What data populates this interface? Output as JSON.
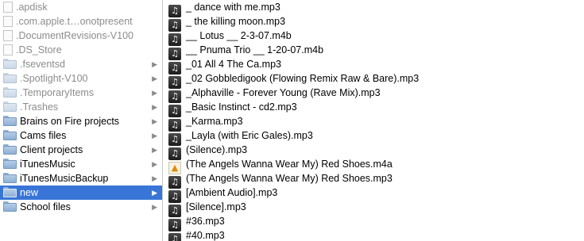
{
  "left_column": {
    "items": [
      {
        "label": ".apdisk",
        "kind": "file",
        "dim": true,
        "has_children": false,
        "selected": false
      },
      {
        "label": ".com.apple.t…onotpresent",
        "kind": "file",
        "dim": true,
        "has_children": false,
        "selected": false
      },
      {
        "label": ".DocumentRevisions-V100",
        "kind": "file",
        "dim": true,
        "has_children": false,
        "selected": false
      },
      {
        "label": ".DS_Store",
        "kind": "file",
        "dim": true,
        "has_children": false,
        "selected": false
      },
      {
        "label": ".fseventsd",
        "kind": "folder",
        "dim": true,
        "has_children": true,
        "selected": false
      },
      {
        "label": ".Spotlight-V100",
        "kind": "folder",
        "dim": true,
        "has_children": true,
        "selected": false
      },
      {
        "label": ".TemporaryItems",
        "kind": "folder",
        "dim": true,
        "has_children": true,
        "selected": false
      },
      {
        "label": ".Trashes",
        "kind": "folder",
        "dim": true,
        "has_children": true,
        "selected": false
      },
      {
        "label": "Brains on Fire projects",
        "kind": "folder",
        "dim": false,
        "has_children": true,
        "selected": false
      },
      {
        "label": "Cams files",
        "kind": "folder",
        "dim": false,
        "has_children": true,
        "selected": false
      },
      {
        "label": "Client projects",
        "kind": "folder",
        "dim": false,
        "has_children": true,
        "selected": false
      },
      {
        "label": "iTunesMusic",
        "kind": "folder",
        "dim": false,
        "has_children": true,
        "selected": false
      },
      {
        "label": "iTunesMusicBackup",
        "kind": "folder",
        "dim": false,
        "has_children": true,
        "selected": false
      },
      {
        "label": "new",
        "kind": "folder",
        "dim": false,
        "has_children": true,
        "selected": true
      },
      {
        "label": "School files",
        "kind": "folder",
        "dim": false,
        "has_children": true,
        "selected": false
      }
    ]
  },
  "right_column": {
    "items": [
      {
        "label": "_ dance with me.mp3",
        "icon": "music"
      },
      {
        "label": "_ the killing moon.mp3",
        "icon": "music"
      },
      {
        "label": "__ Lotus __ 2-3-07.m4b",
        "icon": "music"
      },
      {
        "label": "__ Pnuma Trio __ 1-20-07.m4b",
        "icon": "music"
      },
      {
        "label": "_01 All 4 The Ca.mp3",
        "icon": "music"
      },
      {
        "label": "_02 Gobbledigook (Flowing Remix Raw & Bare).mp3",
        "icon": "music"
      },
      {
        "label": "_Alphaville - Forever Young (Rave Mix).mp3",
        "icon": "music"
      },
      {
        "label": "_Basic Instinct - cd2.mp3",
        "icon": "music"
      },
      {
        "label": "_Karma.mp3",
        "icon": "music"
      },
      {
        "label": "_Layla (with  Eric Gales).mp3",
        "icon": "music"
      },
      {
        "label": "(Silence).mp3",
        "icon": "music"
      },
      {
        "label": "(The Angels Wanna Wear My) Red Shoes.m4a",
        "icon": "vlc"
      },
      {
        "label": "(The Angels Wanna Wear My) Red Shoes.mp3",
        "icon": "music"
      },
      {
        "label": "[Ambient Audio].mp3",
        "icon": "music"
      },
      {
        "label": "[Silence].mp3",
        "icon": "music"
      },
      {
        "label": "#36.mp3",
        "icon": "music"
      },
      {
        "label": "#40.mp3",
        "icon": "music"
      }
    ]
  },
  "glyphs": {
    "chevron": "▶",
    "music_note": "♫",
    "vlc_cone": "▲"
  },
  "colors": {
    "selection": "#3875d7",
    "dim_text": "#8c8c8c",
    "divider": "#c8c8c8"
  }
}
